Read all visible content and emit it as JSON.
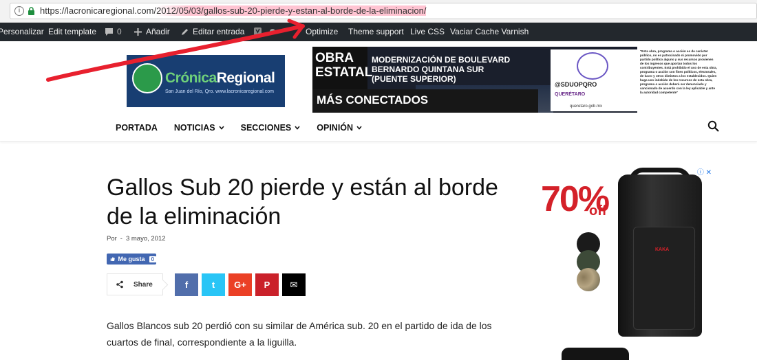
{
  "browser": {
    "url_base": "https://lacronicaregional.com/",
    "url_path": "2012/05/03/gallos-sub-20-pierde-y-estan-al-borde-de-la-eliminacion/"
  },
  "adminbar": {
    "personalizar": "Personalizar",
    "edit_template": "Edit template",
    "comments_count": "0",
    "anadir": "Añadir",
    "editar_entrada": "Editar entrada",
    "optimize": "Optimize",
    "theme_support": "Theme support",
    "live_css": "Live CSS",
    "vaciar_cache": "Vaciar Cache Varnish"
  },
  "logo": {
    "name_part1": "Crónica",
    "name_part2": "Regional",
    "tagline": "San Juan del Río, Qro. www.lacronicaregional.com"
  },
  "banner": {
    "obra_line1": "OBRA",
    "obra_line2": "ESTATAL",
    "mas_conectados": "MÁS CONECTADOS",
    "heading_line1": "MODERNIZACIÓN DE BOULEVARD",
    "heading_line2": "BERNARDO QUINTANA SUR",
    "heading_line3": "(PUENTE SUPERIOR)",
    "social_handle": "@SDUOPQRO",
    "queretaro": "QUERÉTARO",
    "gov_url": "queretaro.gob.mx",
    "legal_text": "\"Esta obra, programa o acción es de carácter público, no es patrocinado ni promovido por partido político alguno y sus recursos provienen de los ingresos que aportan todos los contribuyentes. Está prohibido el uso de esta obra, programa o acción con fines políticos, electorales, de lucro y otros distintos a los establecidos. Quien haga uso indebido de los recursos de esta obra, programa o acción deberá ser denunciado y sancionado de acuerdo con la ley aplicable y ante la autoridad competente\""
  },
  "nav": {
    "items": [
      {
        "label": "PORTADA",
        "dropdown": false
      },
      {
        "label": "NOTICIAS",
        "dropdown": true
      },
      {
        "label": "SECCIONES",
        "dropdown": true
      },
      {
        "label": "OPINIÓN",
        "dropdown": true
      }
    ]
  },
  "article": {
    "title": "Gallos Sub 20 pierde y están al borde de la eliminación",
    "author_prefix": "Por",
    "separator": "-",
    "date": "3 mayo, 2012",
    "fb_like_label": "Me gusta",
    "fb_like_count": "0",
    "share_label": "Share",
    "body": "Gallos Blancos sub 20 perdió con su similar de América sub. 20 en el partido de ida de los cuartos de final, correspondiente a la liguilla."
  },
  "share_buttons": [
    {
      "name": "facebook",
      "glyph": "f",
      "color": "#516eab"
    },
    {
      "name": "twitter",
      "glyph": "t",
      "color": "#29c5f6"
    },
    {
      "name": "googleplus",
      "glyph": "G+",
      "color": "#eb4026"
    },
    {
      "name": "pinterest",
      "glyph": "P",
      "color": "#ca212a"
    },
    {
      "name": "email",
      "glyph": "✉",
      "color": "#000000"
    }
  ],
  "ad": {
    "percent": "70%",
    "off": "off",
    "brand": "KAKA"
  },
  "colors": {
    "adminbar_bg": "#23282d",
    "logo_bg": "#183e72",
    "accent_red": "#d42129",
    "fb_blue": "#4267b2",
    "annotation_red": "#e8202e"
  }
}
